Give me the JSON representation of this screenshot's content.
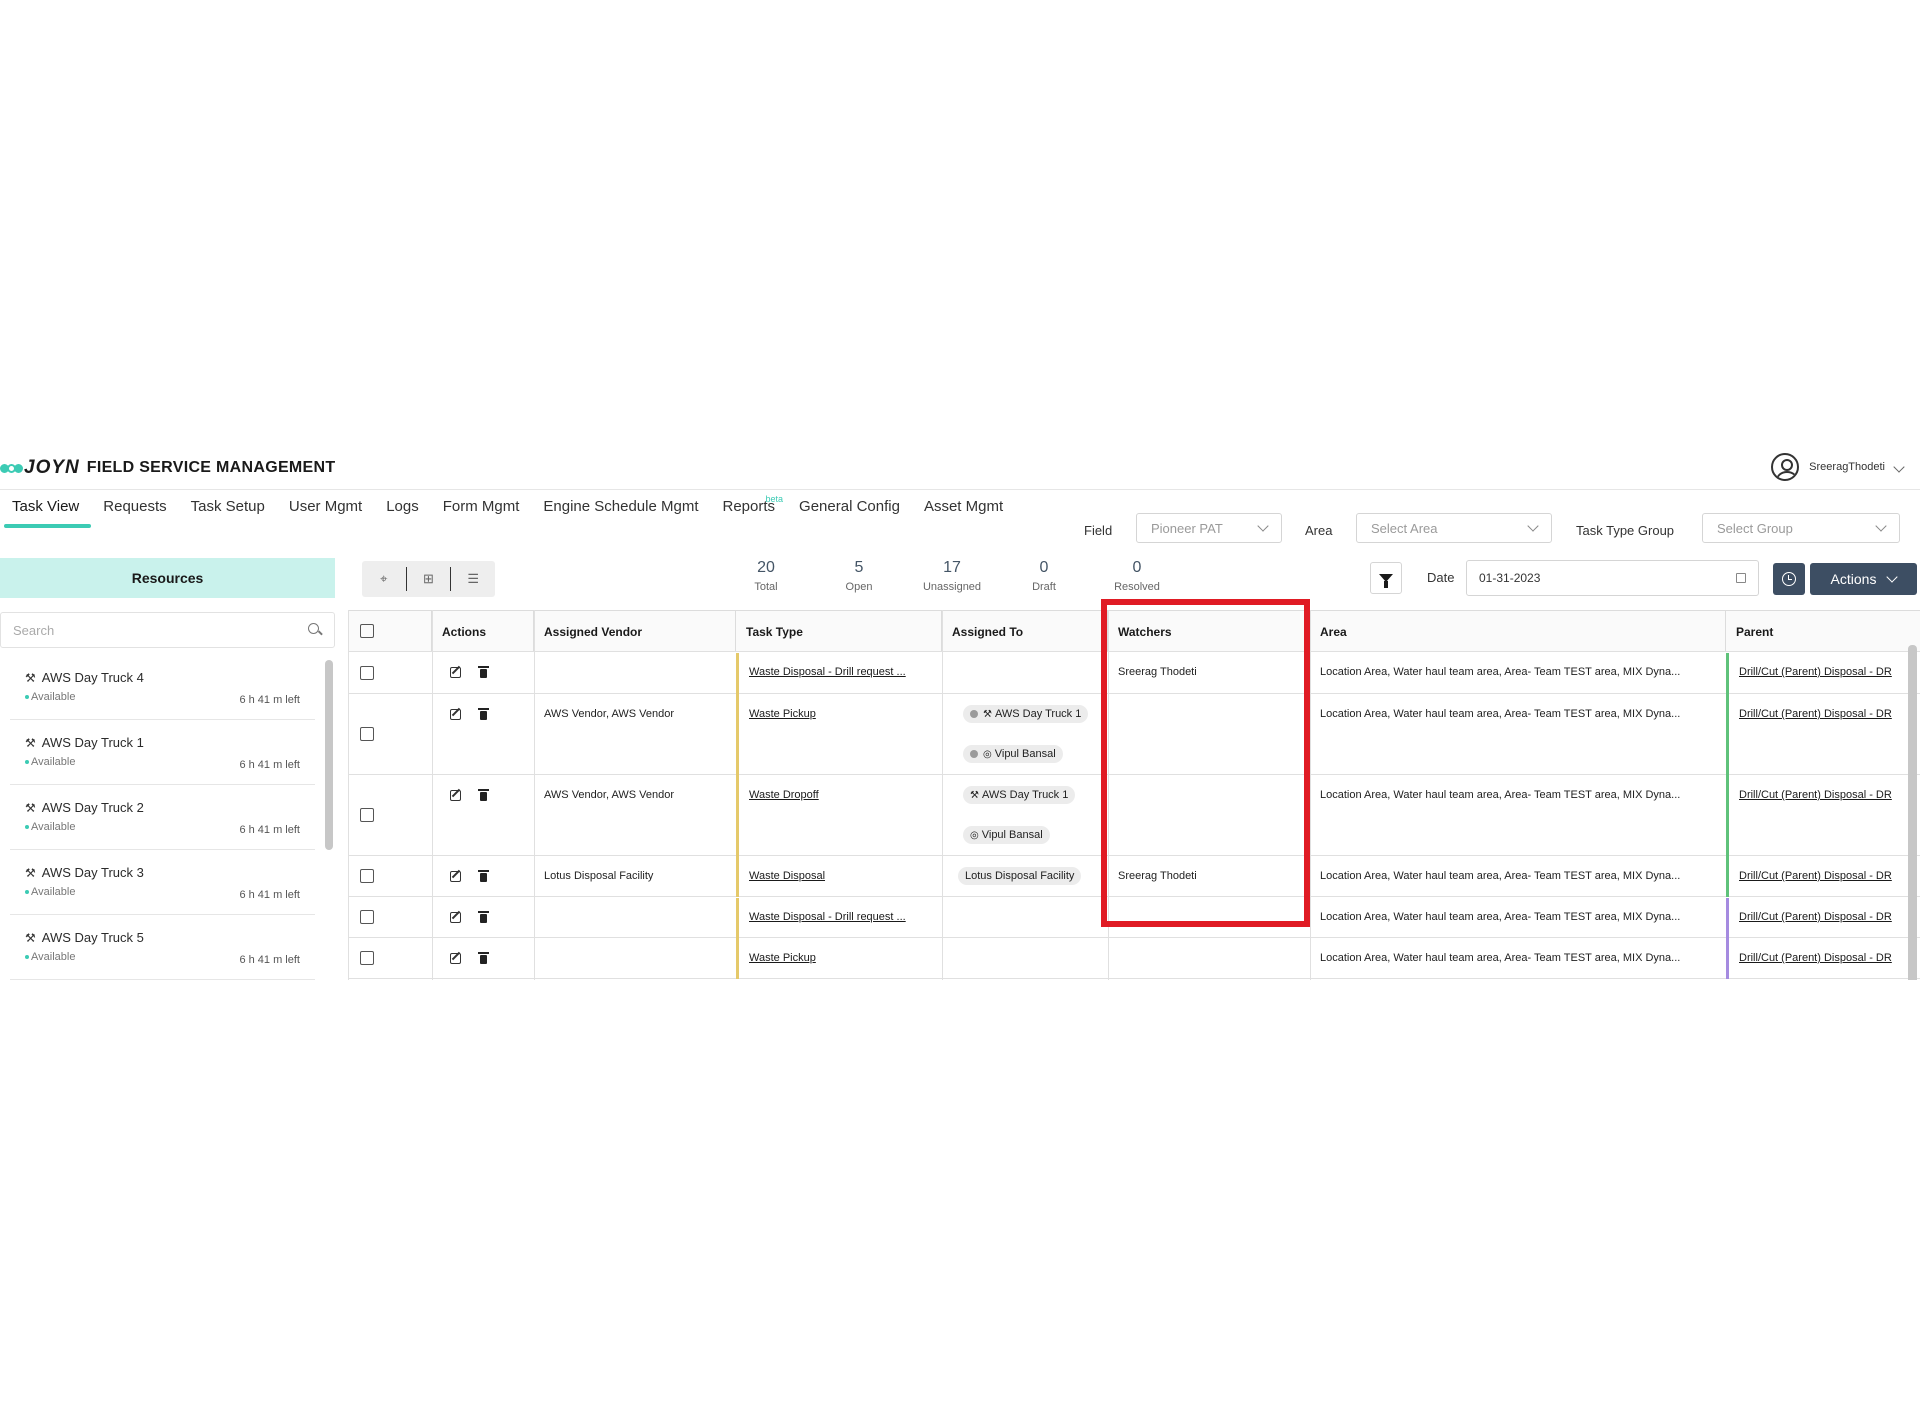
{
  "app": {
    "logo_text": "JOYN",
    "title": "FIELD SERVICE MANAGEMENT",
    "username": "SreeragThodeti"
  },
  "nav": {
    "tabs": [
      {
        "label": "Task View",
        "active": true
      },
      {
        "label": "Requests"
      },
      {
        "label": "Task Setup"
      },
      {
        "label": "User Mgmt"
      },
      {
        "label": "Logs"
      },
      {
        "label": "Form Mgmt"
      },
      {
        "label": "Engine Schedule Mgmt"
      },
      {
        "label": "Reports",
        "badge": "beta"
      },
      {
        "label": "General Config"
      },
      {
        "label": "Asset Mgmt"
      }
    ]
  },
  "filters": {
    "field_label": "Field",
    "field_value": "Pioneer PAT",
    "area_label": "Area",
    "area_placeholder": "Select Area",
    "group_label": "Task Type Group",
    "group_placeholder": "Select Group"
  },
  "sidebar": {
    "resources_label": "Resources",
    "search_placeholder": "Search",
    "items": [
      {
        "name": "AWS Day Truck 4",
        "status": "Available",
        "time_left": "6 h 41 m left"
      },
      {
        "name": "AWS Day Truck 1",
        "status": "Available",
        "time_left": "6 h 41 m left"
      },
      {
        "name": "AWS Day Truck 2",
        "status": "Available",
        "time_left": "6 h 41 m left"
      },
      {
        "name": "AWS Day Truck 3",
        "status": "Available",
        "time_left": "6 h 41 m left"
      },
      {
        "name": "AWS Day Truck 5",
        "status": "Available",
        "time_left": "6 h 41 m left"
      }
    ]
  },
  "counts": [
    {
      "value": "20",
      "label": "Total"
    },
    {
      "value": "5",
      "label": "Open"
    },
    {
      "value": "17",
      "label": "Unassigned"
    },
    {
      "value": "0",
      "label": "Draft"
    },
    {
      "value": "0",
      "label": "Resolved"
    }
  ],
  "toolbar": {
    "date_label": "Date",
    "date_value": "01-31-2023",
    "actions_label": "Actions"
  },
  "table": {
    "headers": {
      "actions": "Actions",
      "vendor": "Assigned Vendor",
      "task_type": "Task Type",
      "assigned_to": "Assigned To",
      "watchers": "Watchers",
      "area": "Area",
      "parent": "Parent"
    },
    "rows": [
      {
        "vendor": "",
        "task_type": "Waste Disposal - Drill request ...",
        "assigned_to": [],
        "watchers": "Sreerag Thodeti",
        "area": "Location Area, Water haul team area, Area- Team TEST area, MIX Dyna...",
        "parent": "Drill/Cut (Parent) Disposal - DR"
      },
      {
        "vendor": "AWS Vendor, AWS Vendor",
        "task_type": "Waste Pickup",
        "assigned_to": [
          "AWS Day Truck 1",
          "Vipul Bansal"
        ],
        "watchers": "",
        "area": "Location Area, Water haul team area, Area- Team TEST area, MIX Dyna...",
        "parent": "Drill/Cut (Parent) Disposal - DR"
      },
      {
        "vendor": "AWS Vendor, AWS Vendor",
        "task_type": "Waste Dropoff",
        "assigned_to": [
          "AWS Day Truck 1",
          "Vipul Bansal"
        ],
        "watchers": "",
        "area": "Location Area, Water haul team area, Area- Team TEST area, MIX Dyna...",
        "parent": "Drill/Cut (Parent) Disposal - DR"
      },
      {
        "vendor": "Lotus Disposal Facility",
        "task_type": "Waste Disposal",
        "assigned_to": [
          "Lotus Disposal Facility"
        ],
        "watchers": "Sreerag Thodeti",
        "area": "Location Area, Water haul team area, Area- Team TEST area, MIX Dyna...",
        "parent": "Drill/Cut (Parent) Disposal - DR"
      },
      {
        "vendor": "",
        "task_type": "Waste Disposal - Drill request ...",
        "assigned_to": [],
        "watchers": "",
        "area": "Location Area, Water haul team area, Area- Team TEST area, MIX Dyna...",
        "parent": "Drill/Cut (Parent) Disposal - DR"
      },
      {
        "vendor": "",
        "task_type": "Waste Pickup",
        "assigned_to": [],
        "watchers": "",
        "area": "Location Area, Water haul team area, Area- Team TEST area, MIX Dyna...",
        "parent": "Drill/Cut (Parent) Disposal - DR"
      }
    ]
  },
  "colors": {
    "accent": "#3ccbb4",
    "resources_bg": "#c9f2ec",
    "button_dark": "#3d4e63",
    "highlight": "#e01b24",
    "row_bar_yellow": "#e5c96a",
    "row_bar_green": "#5fc27a",
    "row_bar_purple": "#a58be0"
  }
}
